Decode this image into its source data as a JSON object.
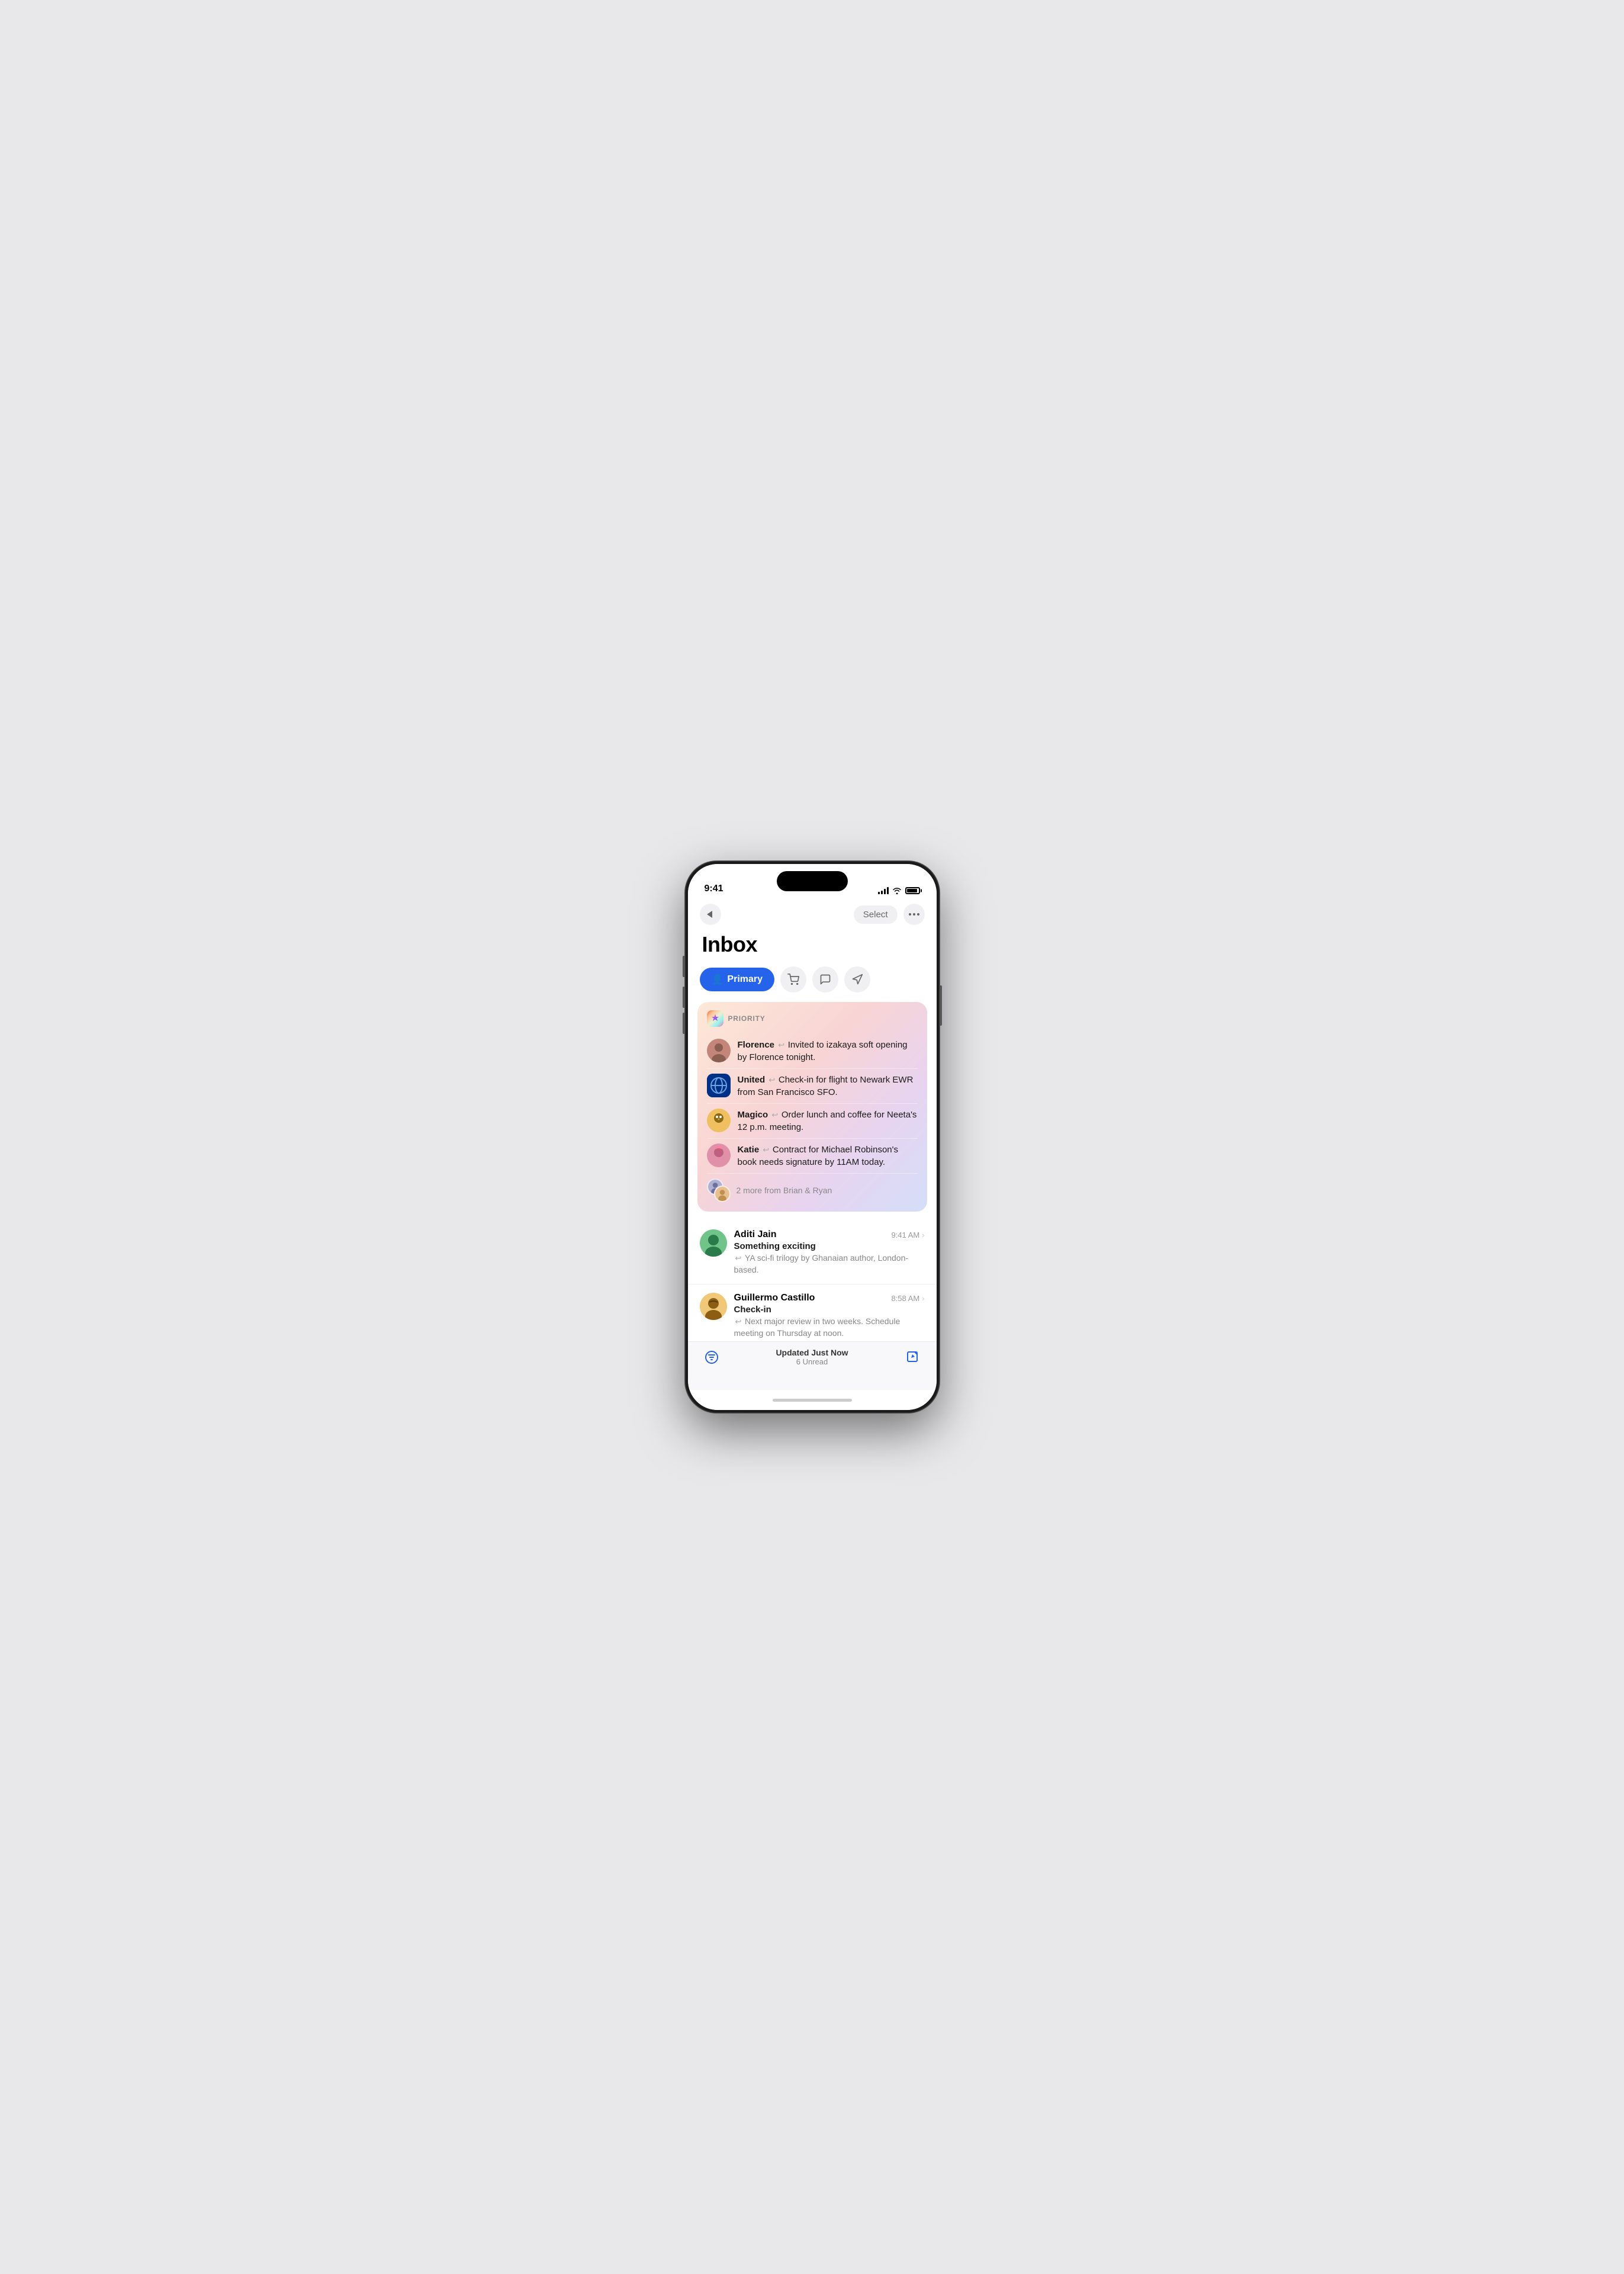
{
  "phone": {
    "status_bar": {
      "time": "9:41",
      "signal": 4,
      "wifi": true,
      "battery": 90
    }
  },
  "nav": {
    "back_label": "Back",
    "select_label": "Select",
    "more_label": "More"
  },
  "header": {
    "title": "Inbox"
  },
  "filter_tabs": {
    "primary": {
      "label": "Primary",
      "active": true
    },
    "shopping": {
      "label": "Shopping"
    },
    "messages": {
      "label": "Messages"
    },
    "promotions": {
      "label": "Promotions"
    }
  },
  "priority_section": {
    "label": "PRIORITY",
    "items": [
      {
        "sender": "Florence",
        "preview": "Invited to izakaya soft opening by Florence tonight.",
        "avatar": "florence"
      },
      {
        "sender": "United",
        "preview": "Check-in for flight to Newark EWR from San Francisco SFO.",
        "avatar": "united"
      },
      {
        "sender": "Magico",
        "preview": "Order lunch and coffee for Neeta's 12 p.m. meeting.",
        "avatar": "magico"
      },
      {
        "sender": "Katie",
        "preview": "Contract for Michael Robinson's book needs signature by 11AM today.",
        "avatar": "katie"
      }
    ],
    "more_text": "2 more from Brian & Ryan"
  },
  "email_list": [
    {
      "sender": "Aditi Jain",
      "time": "9:41 AM",
      "subject": "Something exciting",
      "preview": "YA sci-fi trilogy by Ghanaian author, London-based.",
      "avatar": "aditi",
      "has_summary": true
    },
    {
      "sender": "Guillermo Castillo",
      "time": "8:58 AM",
      "subject": "Check-in",
      "preview": "Next major review in two weeks. Schedule meeting on Thursday at noon.",
      "avatar": "guillermo",
      "has_summary": true
    }
  ],
  "bottom_bar": {
    "updated_label": "Updated Just Now",
    "unread_label": "6 Unread",
    "compose_label": "Compose",
    "filter_label": "Filter"
  }
}
